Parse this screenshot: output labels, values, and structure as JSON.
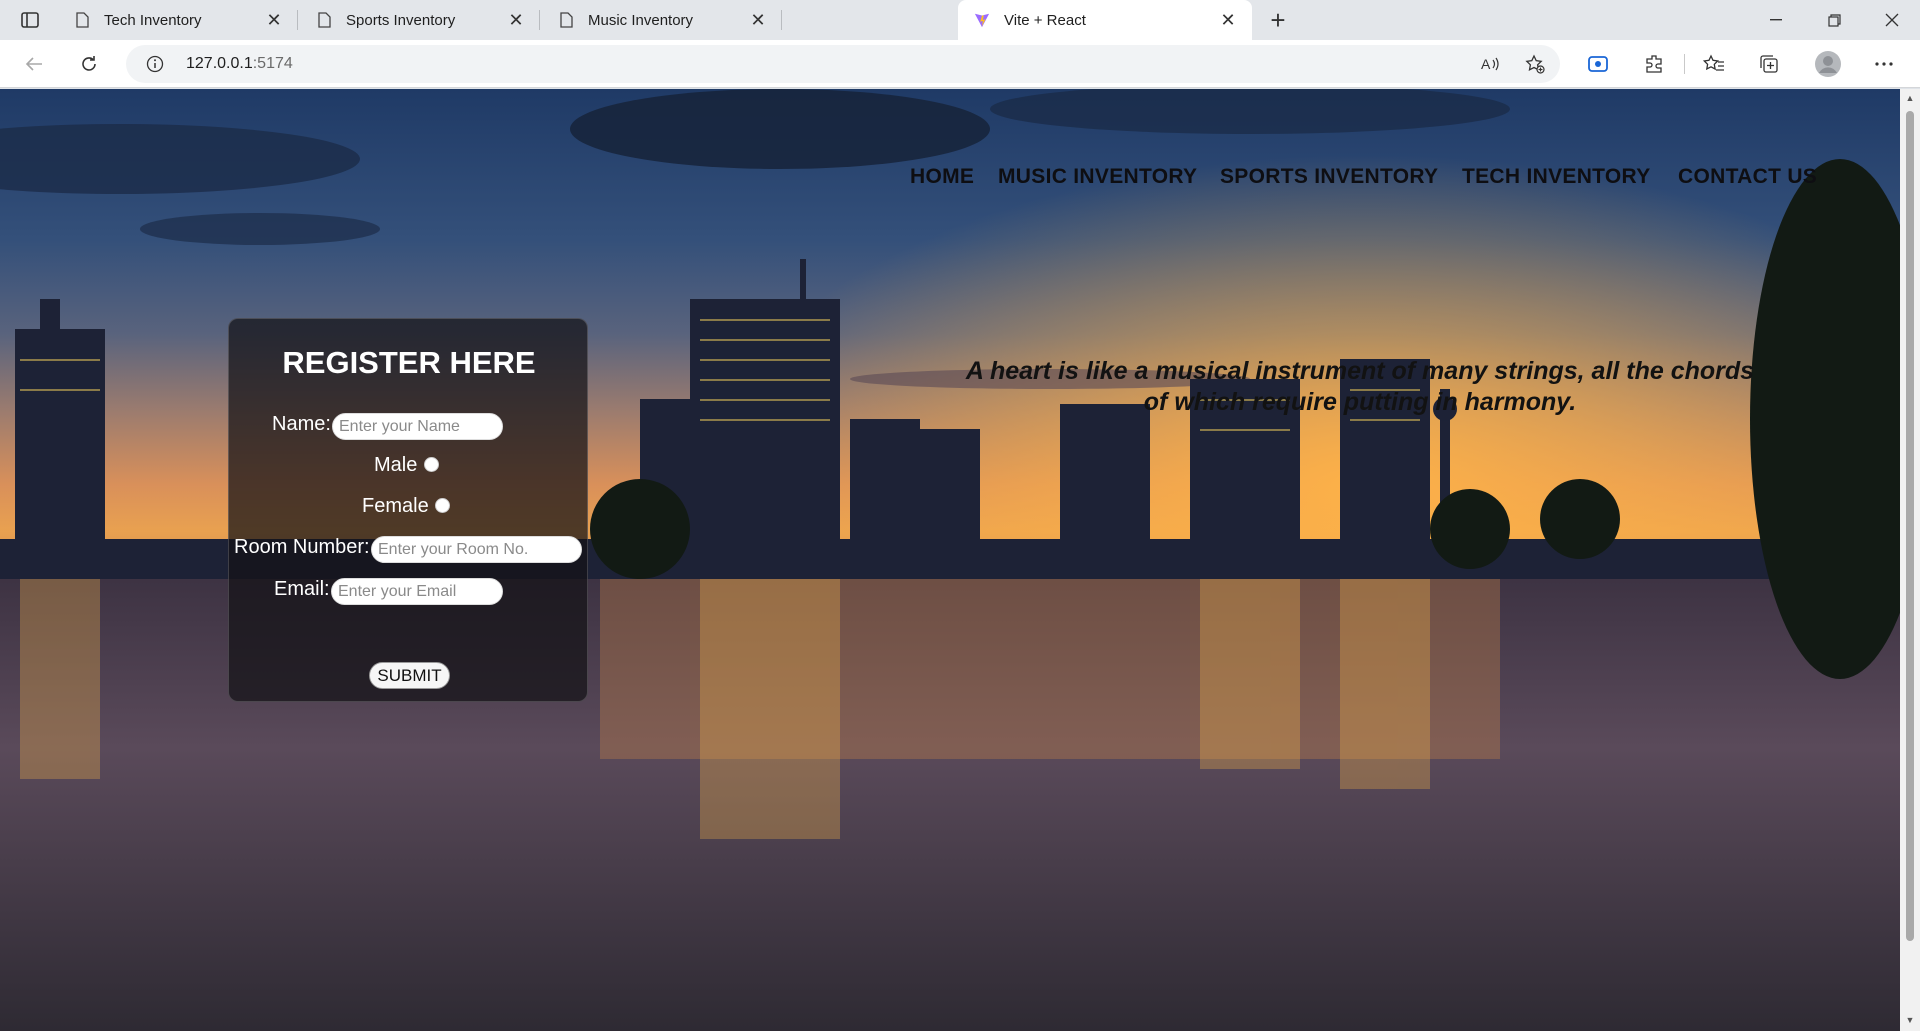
{
  "browser": {
    "tabs": [
      {
        "title": "Tech Inventory",
        "active": false
      },
      {
        "title": "Sports Inventory",
        "active": false
      },
      {
        "title": "Music Inventory",
        "active": false
      },
      {
        "title": "Vite + React",
        "active": true
      }
    ],
    "url_host": "127.0.0.1",
    "url_port": ":5174"
  },
  "page": {
    "nav": [
      "HOME",
      "MUSIC INVENTORY",
      "SPORTS INVENTORY",
      "TECH INVENTORY",
      "CONTACT US"
    ],
    "quote": "A heart is like a musical instrument of many strings, all the chords of which require putting in harmony.",
    "form": {
      "title": "REGISTER HERE",
      "name_label": "Name:",
      "name_placeholder": "Enter your Name",
      "male_label": "Male",
      "female_label": "Female",
      "room_label": "Room Number:",
      "room_placeholder": "Enter your Room No.",
      "email_label": "Email:",
      "email_placeholder": "Enter your Email",
      "submit_label": "SUBMIT"
    }
  },
  "colors": {
    "chrome_bg": "#e3e6ea",
    "active_tab": "#ffffff",
    "accent_blue": "#1a66d6",
    "nav_text": "#0e0e12",
    "card_bg": "#141216"
  }
}
